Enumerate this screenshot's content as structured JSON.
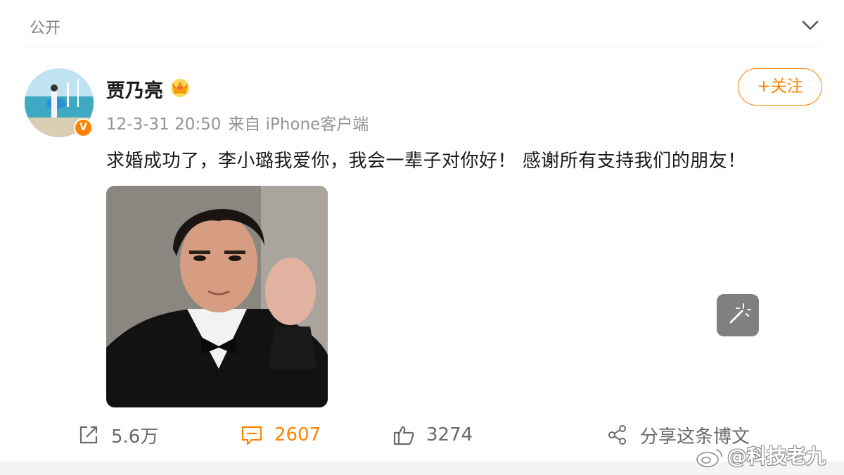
{
  "header": {
    "visibility": "公开"
  },
  "post": {
    "author": "贾乃亮",
    "time": "12-3-31 20:50",
    "source": "来自 iPhone客户端",
    "follow_label": "+关注",
    "text": "求婚成功了，李小璐我爱你，我会一辈子对你好！ 感谢所有支持我们的朋友！",
    "verified_badge": "V"
  },
  "actions": {
    "repost": "5.6万",
    "comment": "2607",
    "like": "3274",
    "share": "分享这条博文"
  },
  "watermark": {
    "text": "@科技老九"
  },
  "colors": {
    "accent": "#ff8200",
    "muted": "#939393"
  }
}
